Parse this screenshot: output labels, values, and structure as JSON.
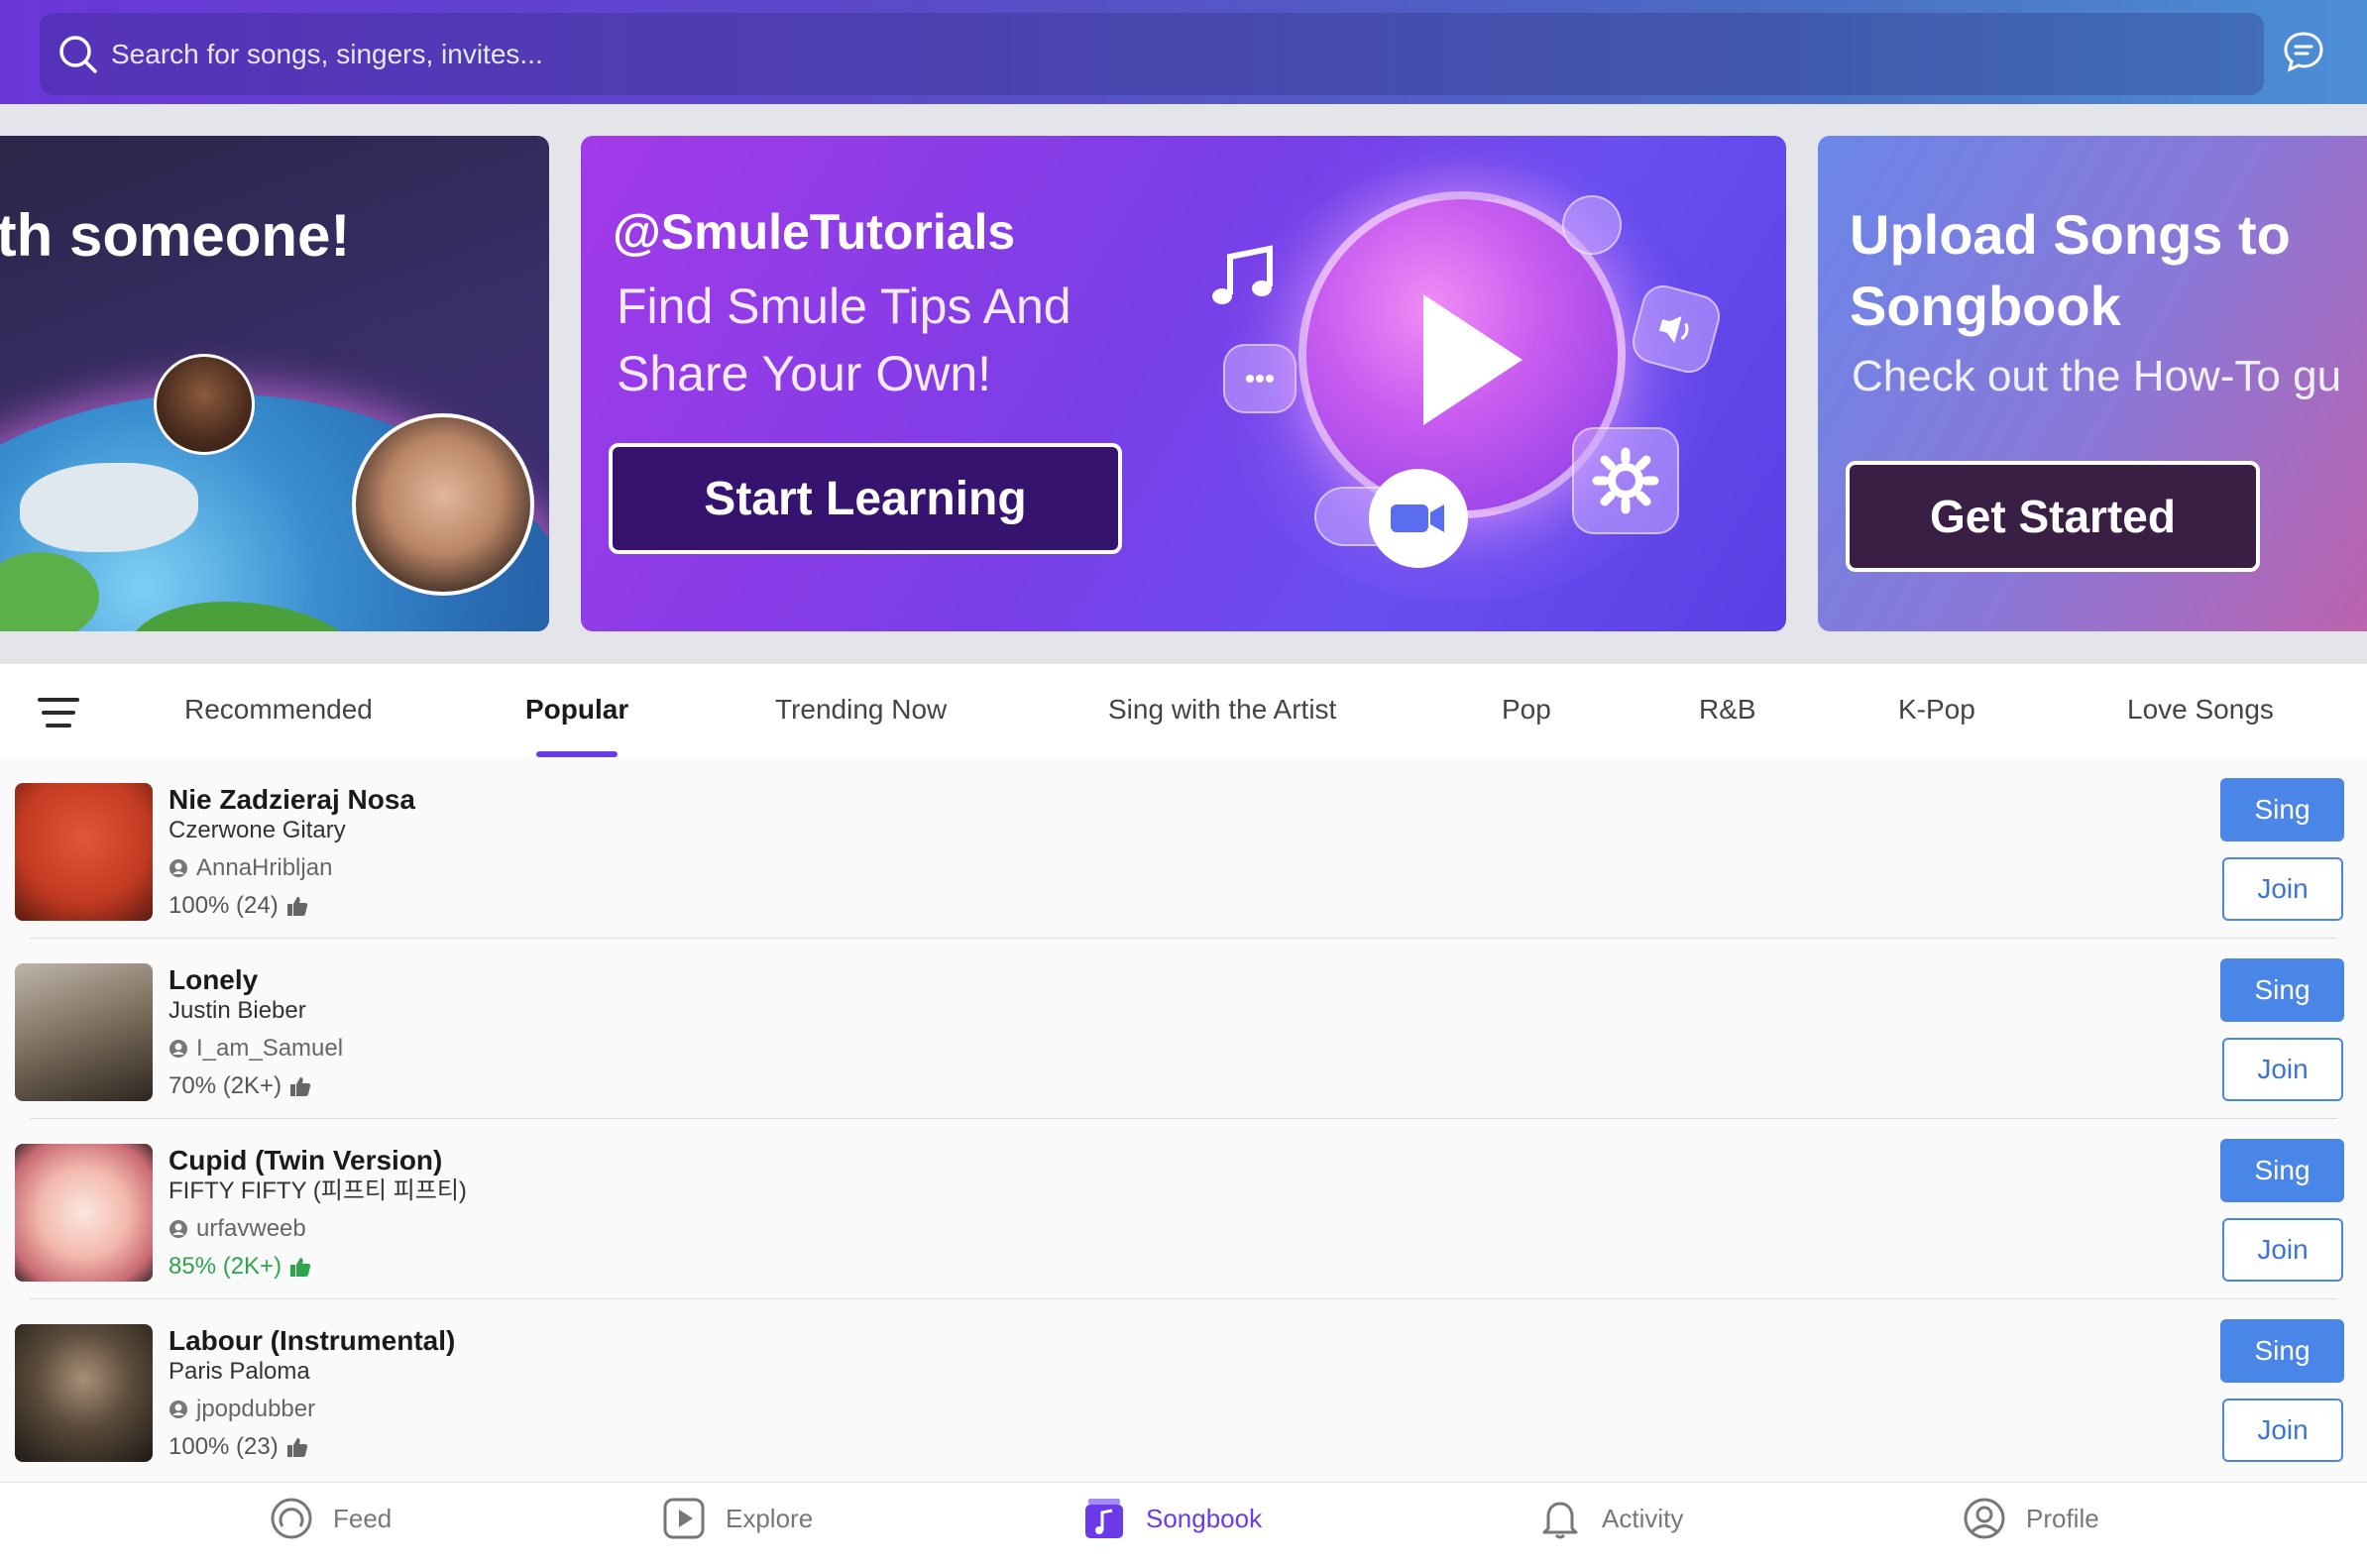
{
  "search": {
    "placeholder": "Search for songs, singers, invites..."
  },
  "banners": [
    {
      "title": "ith someone!"
    },
    {
      "handle": "@SmuleTutorials",
      "subtitle": "Find Smule Tips And Share Your Own!",
      "cta": "Start Learning"
    },
    {
      "title_line1": "Upload Songs to",
      "title_line2": "Songbook",
      "subtitle": "Check out the How-To gu",
      "cta": "Get Started"
    }
  ],
  "tabs": [
    {
      "label": "Recommended"
    },
    {
      "label": "Popular",
      "active": true
    },
    {
      "label": "Trending Now"
    },
    {
      "label": "Sing with the Artist"
    },
    {
      "label": "Pop"
    },
    {
      "label": "R&B"
    },
    {
      "label": "K-Pop"
    },
    {
      "label": "Love Songs"
    }
  ],
  "songs": [
    {
      "title": "Nie Zadzieraj Nosa",
      "artist": "Czerwone Gitary",
      "user": "AnnaHribljan",
      "rating": "100% (24)",
      "sing": "Sing",
      "join": "Join"
    },
    {
      "title": "Lonely",
      "artist": "Justin Bieber",
      "user": "I_am_Samuel",
      "rating": "70% (2K+)",
      "sing": "Sing",
      "join": "Join"
    },
    {
      "title": "Cupid (Twin Version)",
      "artist": "FIFTY FIFTY (피프티 피프티)",
      "user": "urfavweeb",
      "rating": "85% (2K+)",
      "rating_color": "#2fa44a",
      "sing": "Sing",
      "join": "Join"
    },
    {
      "title": "Labour (Instrumental)",
      "artist": "Paris Paloma",
      "user": "jpopdubber",
      "rating": "100% (23)",
      "sing": "Sing",
      "join": "Join"
    }
  ],
  "nav": [
    {
      "label": "Feed",
      "icon": "feed-icon"
    },
    {
      "label": "Explore",
      "icon": "explore-icon"
    },
    {
      "label": "Songbook",
      "icon": "songbook-icon",
      "active": true
    },
    {
      "label": "Activity",
      "icon": "bell-icon"
    },
    {
      "label": "Profile",
      "icon": "profile-icon"
    }
  ],
  "colors": {
    "accent": "#6b3bea",
    "sing_button": "#4a86e8",
    "rating_good": "#2fa44a"
  }
}
